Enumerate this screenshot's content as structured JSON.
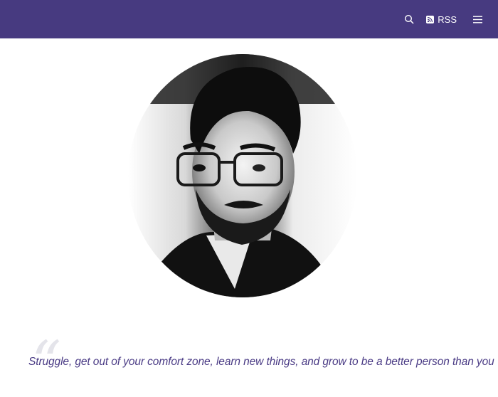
{
  "header": {
    "background_color": "#473a80",
    "search_icon": "search-icon",
    "rss_icon": "rss-icon",
    "rss_label": "RSS",
    "menu_icon": "hamburger-menu-icon"
  },
  "hero": {
    "avatar": "profile-photo"
  },
  "quote": {
    "mark": "“",
    "text": "Struggle, get out of your comfort zone, learn new things, and grow to be a better person than you"
  }
}
